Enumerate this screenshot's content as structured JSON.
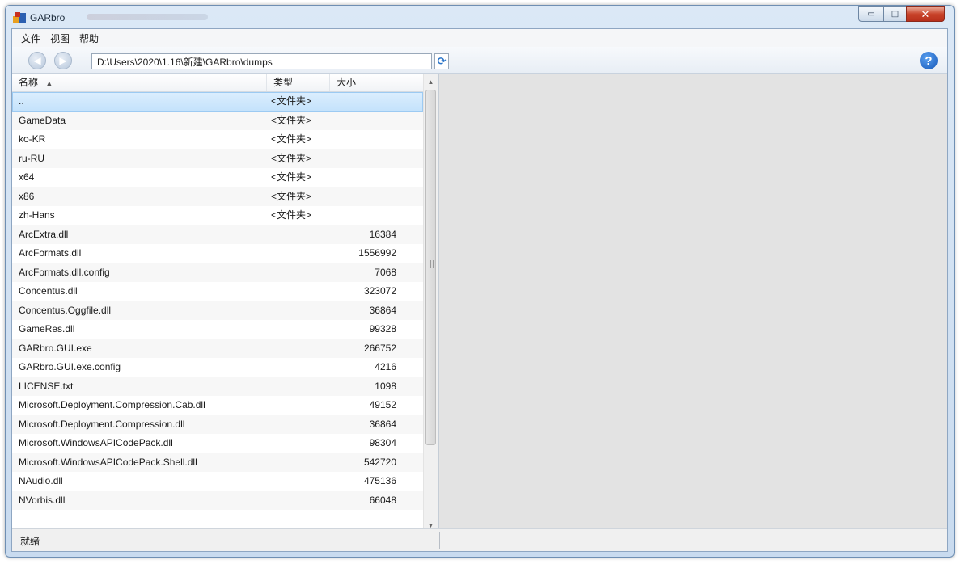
{
  "window": {
    "title": "GARbro"
  },
  "menu": {
    "items": [
      "文件",
      "视图",
      "帮助"
    ]
  },
  "toolbar": {
    "path": "D:\\Users\\2020\\1.16\\新建\\GARbro\\dumps",
    "back_icon": "back-arrow-icon",
    "forward_icon": "forward-arrow-icon",
    "refresh_icon": "refresh-icon",
    "help_icon": "help-icon"
  },
  "list": {
    "columns": {
      "name": "名称",
      "type": "类型",
      "size": "大小"
    },
    "rows": [
      {
        "name": "..",
        "type": "<文件夹>",
        "size": ""
      },
      {
        "name": "GameData",
        "type": "<文件夹>",
        "size": ""
      },
      {
        "name": "ko-KR",
        "type": "<文件夹>",
        "size": ""
      },
      {
        "name": "ru-RU",
        "type": "<文件夹>",
        "size": ""
      },
      {
        "name": "x64",
        "type": "<文件夹>",
        "size": ""
      },
      {
        "name": "x86",
        "type": "<文件夹>",
        "size": ""
      },
      {
        "name": "zh-Hans",
        "type": "<文件夹>",
        "size": ""
      },
      {
        "name": "ArcExtra.dll",
        "type": "",
        "size": "16384"
      },
      {
        "name": "ArcFormats.dll",
        "type": "",
        "size": "1556992"
      },
      {
        "name": "ArcFormats.dll.config",
        "type": "",
        "size": "7068"
      },
      {
        "name": "Concentus.dll",
        "type": "",
        "size": "323072"
      },
      {
        "name": "Concentus.Oggfile.dll",
        "type": "",
        "size": "36864"
      },
      {
        "name": "GameRes.dll",
        "type": "",
        "size": "99328"
      },
      {
        "name": "GARbro.GUI.exe",
        "type": "",
        "size": "266752"
      },
      {
        "name": "GARbro.GUI.exe.config",
        "type": "",
        "size": "4216"
      },
      {
        "name": "LICENSE.txt",
        "type": "",
        "size": "1098"
      },
      {
        "name": "Microsoft.Deployment.Compression.Cab.dll",
        "type": "",
        "size": "49152"
      },
      {
        "name": "Microsoft.Deployment.Compression.dll",
        "type": "",
        "size": "36864"
      },
      {
        "name": "Microsoft.WindowsAPICodePack.dll",
        "type": "",
        "size": "98304"
      },
      {
        "name": "Microsoft.WindowsAPICodePack.Shell.dll",
        "type": "",
        "size": "542720"
      },
      {
        "name": "NAudio.dll",
        "type": "",
        "size": "475136"
      },
      {
        "name": "NVorbis.dll",
        "type": "",
        "size": "66048"
      }
    ]
  },
  "status": {
    "text": "就绪"
  }
}
